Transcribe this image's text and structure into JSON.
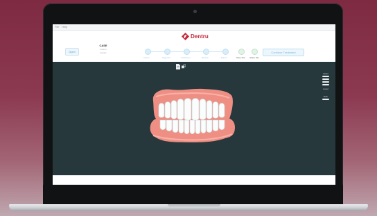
{
  "window": {
    "menu": [
      "File",
      "Help"
    ]
  },
  "header": {
    "logo_text": "Dentru",
    "patient_button": "Open",
    "case": {
      "title": "CASE",
      "subtitle_1": "Patient",
      "subtitle_2": "Details"
    },
    "steps": [
      "Import",
      "Segment",
      "Treatment",
      "Review",
      "Export"
    ],
    "actions": [
      "Save File",
      "Share File"
    ],
    "primary_button": "Continue Treatment"
  },
  "viewport": {
    "tools": [
      "document-icon",
      "view-icon"
    ],
    "side_panel": {
      "top_label": "Upper Jaw",
      "middle_label": "Lower",
      "bottom_label": "Both"
    },
    "model": "3d-teeth-model"
  },
  "status": {
    "text": ""
  },
  "colors": {
    "brand": "#c2283a",
    "viewport_bg": "#27383d",
    "accent": "#4ea5d4"
  }
}
